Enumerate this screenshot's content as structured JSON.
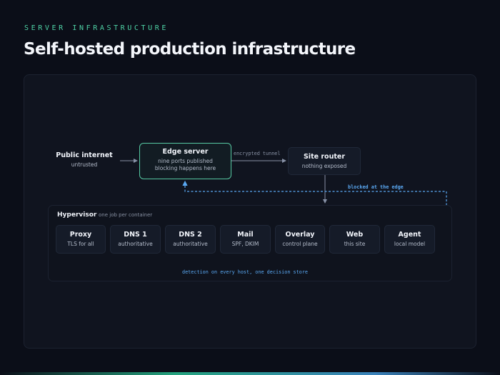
{
  "header": {
    "eyebrow": "SERVER INFRASTRUCTURE",
    "title": "Self-hosted production infrastructure"
  },
  "diagram": {
    "public_internet": {
      "title": "Public internet",
      "subtitle": "untrusted"
    },
    "edge_server": {
      "title": "Edge server",
      "line1": "nine ports published",
      "line2": "blocking happens here"
    },
    "site_router": {
      "title": "Site router",
      "subtitle": "nothing exposed"
    },
    "tunnel_label": "encrypted tunnel",
    "blocked_label": "blocked at the edge",
    "hypervisor": {
      "title": "Hypervisor",
      "subtitle": "one job per container",
      "containers": [
        {
          "title": "Proxy",
          "subtitle": "TLS for all"
        },
        {
          "title": "DNS 1",
          "subtitle": "authoritative"
        },
        {
          "title": "DNS 2",
          "subtitle": "authoritative"
        },
        {
          "title": "Mail",
          "subtitle": "SPF, DKIM"
        },
        {
          "title": "Overlay",
          "subtitle": "control plane"
        },
        {
          "title": "Web",
          "subtitle": "this site"
        },
        {
          "title": "Agent",
          "subtitle": "local model"
        }
      ],
      "detection_label": "detection on every host, one decision store"
    }
  },
  "colors": {
    "accent_green": "#4fd3a6",
    "accent_blue": "#5aa8f2",
    "background": "#0b0e18"
  }
}
